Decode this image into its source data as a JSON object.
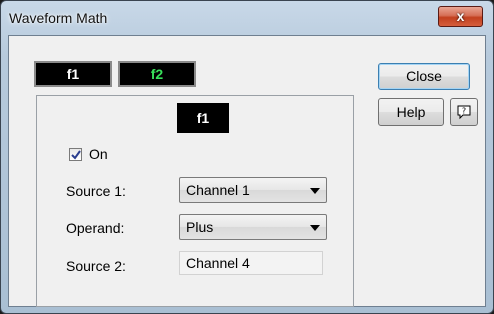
{
  "window": {
    "title": "Waveform Math",
    "close_glyph": "x"
  },
  "tabs": [
    {
      "label": "f1",
      "color": "#ffffff"
    },
    {
      "label": "f2",
      "color": "#38e05a"
    }
  ],
  "panel": {
    "header": "f1",
    "on": {
      "label": "On",
      "checked": true
    },
    "source1": {
      "label": "Source 1:",
      "value": "Channel 1"
    },
    "operand": {
      "label": "Operand:",
      "value": "Plus"
    },
    "source2": {
      "label": "Source 2:",
      "value": "Channel 4"
    }
  },
  "buttons": {
    "close": "Close",
    "help": "Help",
    "help_icon": "question-icon"
  }
}
